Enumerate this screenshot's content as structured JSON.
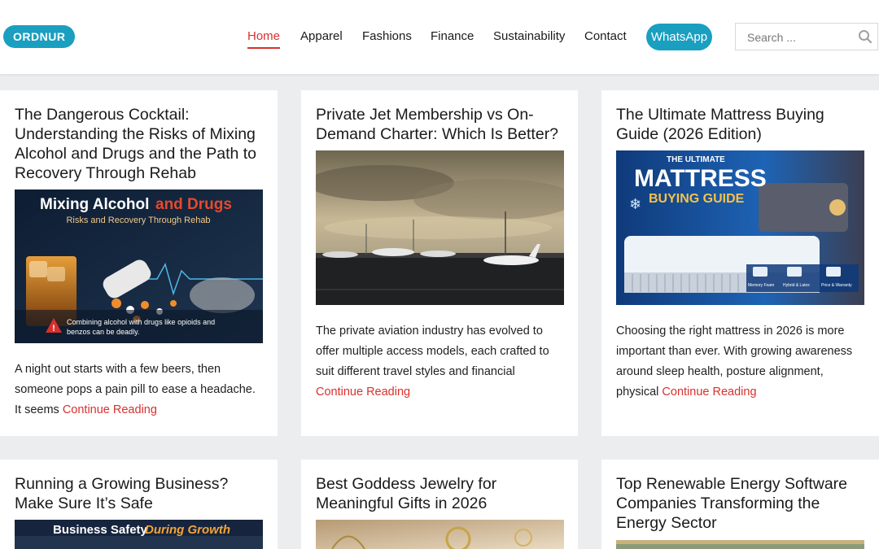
{
  "header": {
    "logo": "ORDNUR",
    "nav": [
      "Home",
      "Apparel",
      "Fashions",
      "Finance",
      "Sustainability",
      "Contact"
    ],
    "whatsapp_label": "WhatsApp",
    "search_placeholder": "Search ..."
  },
  "colors": {
    "accent": "#d9302d",
    "brand": "#1a9fc0",
    "background": "#ebedef"
  },
  "posts": [
    {
      "title": "The Dangerous Cocktail: Understanding the Risks of Mixing Alcohol and Drugs and the Path to Recovery Through Rehab",
      "image_heading_1": "Mixing Alcohol",
      "image_heading_2": "and Drugs",
      "image_subheading": "Risks and Recovery Through Rehab",
      "image_caption": "Combining alcohol with drugs like opioids and benzos can be deadly.",
      "excerpt": "A night out starts with a few beers, then someone pops a pain pill to ease a headache. It seems",
      "read_more": "Continue Reading"
    },
    {
      "title": "Private Jet Membership vs On-Demand Charter: Which Is Better?",
      "excerpt": "The private aviation industry has evolved to offer multiple access models, each crafted to suit different travel styles and financial",
      "read_more": "Continue Reading"
    },
    {
      "title": "The Ultimate Mattress Buying Guide (2026 Edition)",
      "image_heading_1": "THE ULTIMATE",
      "image_heading_2": "MATTRESS",
      "image_heading_3": "BUYING GUIDE",
      "image_labels": [
        "Memory Foam",
        "Hybrid & Latex",
        "Price & Warranty"
      ],
      "excerpt": "Choosing the right mattress in 2026 is more important than ever. With growing awareness around sleep health, posture alignment, physical",
      "read_more": "Continue Reading"
    },
    {
      "title": "Running a Growing Business? Make Sure It’s Safe",
      "image_heading_1": "Business Safety",
      "image_heading_2": "During Growth"
    },
    {
      "title": "Best Goddess Jewelry for Meaningful Gifts in 2026"
    },
    {
      "title": "Top Renewable Energy Software Companies Transforming the Energy Sector"
    }
  ]
}
